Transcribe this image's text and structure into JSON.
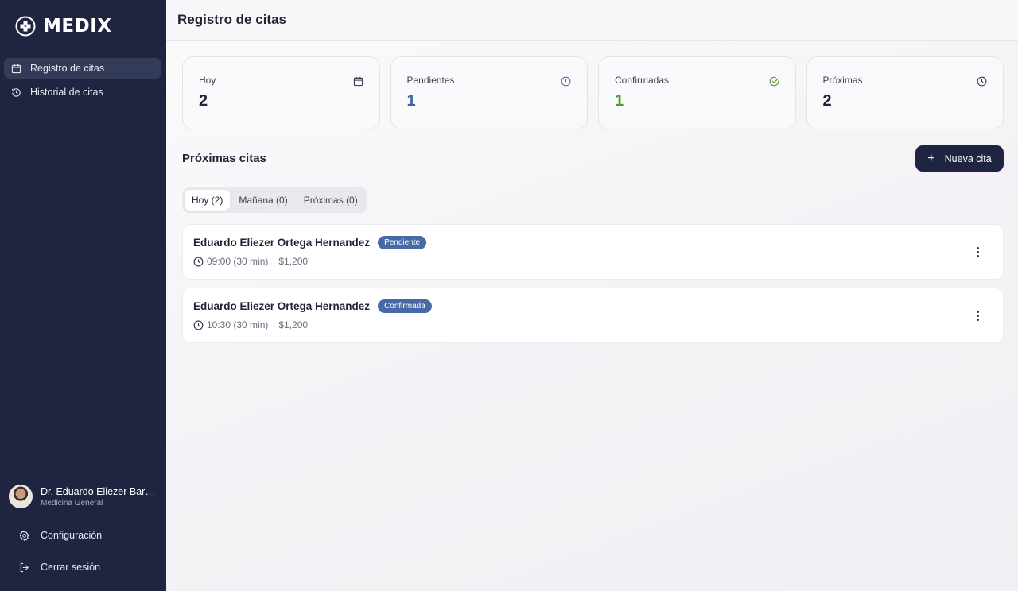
{
  "brand": {
    "name": "MEDIX",
    "icon": "medical-cross-logo"
  },
  "sidebar": {
    "items": [
      {
        "label": "Registro de citas",
        "icon": "calendar-icon",
        "active": true
      },
      {
        "label": "Historial de citas",
        "icon": "history-icon",
        "active": false
      }
    ],
    "user": {
      "name": "Dr. Eduardo Eliezer Barri...",
      "role": "Medicina General"
    },
    "settings_label": "Configuración",
    "logout_label": "Cerrar sesión"
  },
  "header": {
    "title": "Registro de citas"
  },
  "stats": [
    {
      "label": "Hoy",
      "value": "2",
      "icon": "calendar-icon",
      "color": "#1f2437"
    },
    {
      "label": "Pendientes",
      "value": "1",
      "icon": "alert-circle-icon",
      "color": "#3f67a8"
    },
    {
      "label": "Confirmadas",
      "value": "1",
      "icon": "check-circle-icon",
      "color": "#4a9a2d"
    },
    {
      "label": "Próximas",
      "value": "2",
      "icon": "clock-icon",
      "color": "#1f2437"
    }
  ],
  "appointments_section": {
    "title": "Próximas citas",
    "new_button_label": "Nueva cita",
    "tabs": [
      {
        "label": "Hoy (2)",
        "active": true
      },
      {
        "label": "Mañana (0)",
        "active": false
      },
      {
        "label": "Próximas (0)",
        "active": false
      }
    ],
    "items": [
      {
        "patient": "Eduardo Eliezer Ortega Hernandez",
        "status": "Pendiente",
        "time": "09:00 (30 min)",
        "price": "$1,200"
      },
      {
        "patient": "Eduardo Eliezer Ortega Hernandez",
        "status": "Confirmada",
        "time": "10:30 (30 min)",
        "price": "$1,200"
      }
    ]
  },
  "colors": {
    "sidebar": "#1f2540",
    "accent": "#4769a6",
    "success": "#4a9a2d"
  }
}
